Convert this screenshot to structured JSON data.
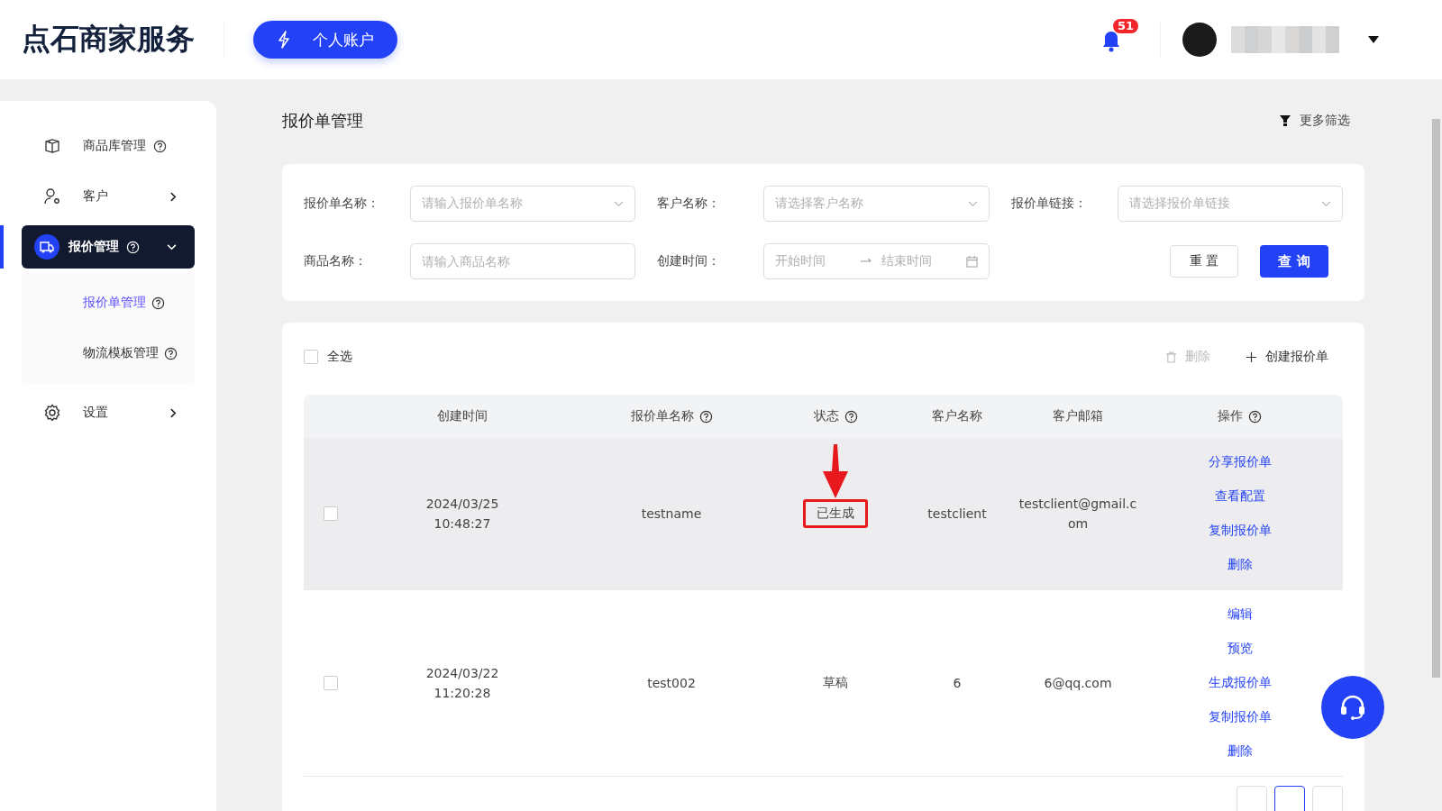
{
  "header": {
    "logo": "点石商家服务",
    "account_button": "个人账户",
    "notification_count": "51"
  },
  "sidebar": {
    "items": [
      {
        "label": "商品库管理",
        "help": true,
        "selected": false,
        "expanded": false
      },
      {
        "label": "客户",
        "help": false,
        "selected": false,
        "expanded": false
      },
      {
        "label": "报价管理",
        "help": true,
        "selected": true,
        "expanded": true,
        "children": [
          {
            "label": "报价单管理",
            "help": true,
            "selected": true
          },
          {
            "label": "物流模板管理",
            "help": true,
            "selected": false
          }
        ]
      },
      {
        "label": "设置",
        "help": false,
        "selected": false,
        "expanded": false
      }
    ]
  },
  "page": {
    "title": "报价单管理",
    "more_filters": "更多筛选"
  },
  "filters": [
    {
      "label": "报价单名称：",
      "placeholder": "请输入报价单名称",
      "kind": "select"
    },
    {
      "label": "客户名称：",
      "placeholder": "请选择客户名称",
      "kind": "select"
    },
    {
      "label": "报价单链接：",
      "placeholder": "请选择报价单链接",
      "kind": "select"
    },
    {
      "label": "商品名称：",
      "placeholder": "请输入商品名称",
      "kind": "text"
    },
    {
      "label": "创建时间：",
      "placeholder": "开始时间",
      "placeholder_end": "结束时间",
      "kind": "daterange"
    }
  ],
  "filter_buttons": {
    "reset": "重 置",
    "query": "查 询"
  },
  "toolbar": {
    "select_all": "全选",
    "select_all_checked": false,
    "delete": "删除",
    "delete_disabled": true,
    "create": "创建报价单"
  },
  "table": {
    "columns": [
      {
        "label": "创建时间",
        "help": false
      },
      {
        "label": "报价单名称",
        "help": true
      },
      {
        "label": "状态",
        "help": true
      },
      {
        "label": "客户名称",
        "help": false
      },
      {
        "label": "客户邮箱",
        "help": false
      },
      {
        "label": "操作",
        "help": true
      }
    ],
    "rows": [
      {
        "checked": false,
        "hovered": true,
        "date": "2024/03/25",
        "time": "10:48:27",
        "name": "testname",
        "status": "已生成",
        "client": "testclient",
        "email": "testclient@gmail.c",
        "email_2": "om",
        "actions": [
          "分享报价单",
          "查看配置",
          "复制报价单",
          "删除"
        ]
      },
      {
        "checked": false,
        "hovered": false,
        "date": "2024/03/22",
        "time": "11:20:28",
        "name": "test002",
        "status": "草稿",
        "client": "6",
        "email": "6@qq.com",
        "email_2": null,
        "actions": [
          "编辑",
          "预览",
          "生成报价单",
          "复制报价单",
          "删除"
        ]
      }
    ]
  }
}
